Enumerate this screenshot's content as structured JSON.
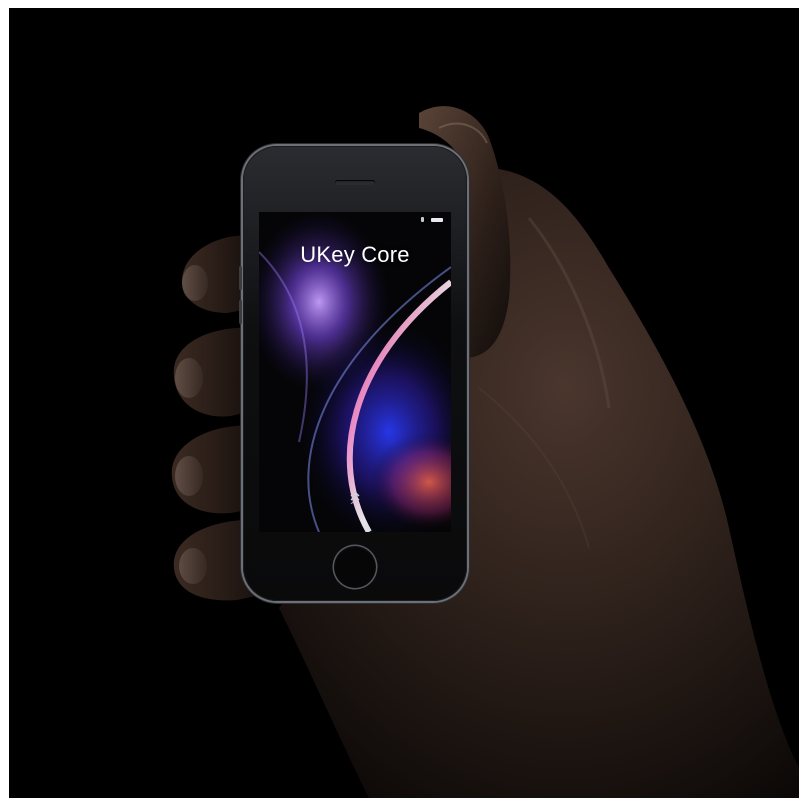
{
  "screen": {
    "title": "UKey Core",
    "icons": [
      "signal-icon",
      "battery-icon",
      "swipe-up-icon"
    ]
  },
  "colors": {
    "background": "#000000",
    "page_border": "#ffffff",
    "phone_frame": "#6d7076",
    "skin_tone": "#3a2a22"
  }
}
